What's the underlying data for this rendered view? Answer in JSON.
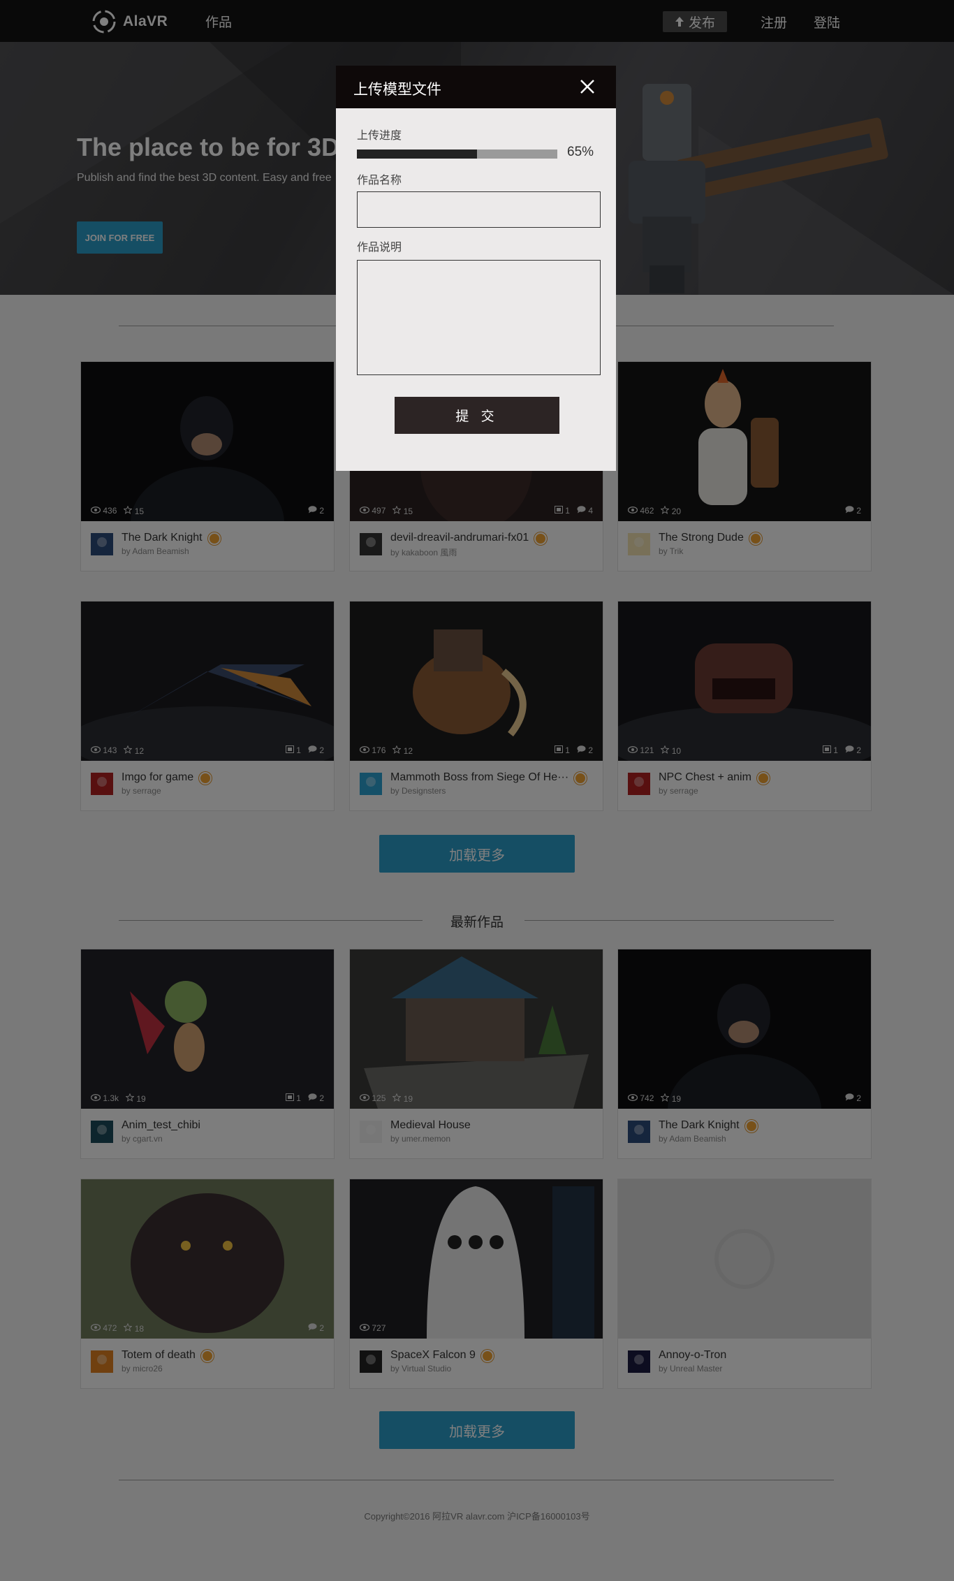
{
  "nav": {
    "logo_text": "AlaVR",
    "works": "作品",
    "publish": "发布",
    "register": "注册",
    "login": "登陆"
  },
  "hero": {
    "title": "The place to be for 3D",
    "subtitle": "Publish and find the best 3D content. Easy and free",
    "join": "JOIN FOR FREE"
  },
  "featured": [
    {
      "title": "The Dark Knight",
      "author": "by Adam Beamish",
      "views": "436",
      "likes": "15",
      "comments": "2",
      "badge": true
    },
    {
      "title": "devil-dreavil-andrumari-fx01",
      "author": "by kakaboon 風雨",
      "views": "497",
      "likes": "15",
      "models": "1",
      "comments": "4",
      "badge": true
    },
    {
      "title": "The Strong Dude",
      "author": "by Trik",
      "views": "462",
      "likes": "20",
      "comments": "2",
      "badge": true
    },
    {
      "title": "Imgo for game",
      "author": "by serrage",
      "views": "143",
      "likes": "12",
      "models": "1",
      "comments": "2",
      "badge": true
    },
    {
      "title": "Mammoth Boss from Siege Of He···",
      "author": "by Designsters",
      "views": "176",
      "likes": "12",
      "models": "1",
      "comments": "2",
      "badge": true
    },
    {
      "title": "NPC Chest + anim",
      "author": "by serrage",
      "views": "121",
      "likes": "10",
      "models": "1",
      "comments": "2",
      "badge": true
    }
  ],
  "load_more": "加载更多",
  "latest_title": "最新作品",
  "latest": [
    {
      "title": "Anim_test_chibi",
      "author": "by cgart.vn",
      "views": "1.3k",
      "likes": "19",
      "models": "1",
      "comments": "2",
      "badge": false
    },
    {
      "title": "Medieval House",
      "author": "by umer.memon",
      "views": "125",
      "likes": "19",
      "badge": false
    },
    {
      "title": "The Dark Knight",
      "author": "by Adam Beamish",
      "views": "742",
      "likes": "19",
      "comments": "2",
      "badge": true
    },
    {
      "title": "Totem of death",
      "author": "by micro26",
      "views": "472",
      "likes": "18",
      "comments": "2",
      "badge": true
    },
    {
      "title": "SpaceX Falcon 9",
      "author": "by Virtual Studio",
      "views": "727",
      "badge": true
    },
    {
      "title": "Annoy-o-Tron",
      "author": "by Unreal Master",
      "badge": false
    }
  ],
  "footer": {
    "copyright": "Copyright©2016 阿拉VR alavr.com 沪ICP备16000103号"
  },
  "modal": {
    "title": "上传模型文件",
    "progress_label": "上传进度",
    "progress": 0.6,
    "progress_text": "65%",
    "name_label": "作品名称",
    "name_value": "",
    "desc_label": "作品说明",
    "desc_value": "",
    "submit": "提 交"
  },
  "colors": {
    "accent": "#2b9cc9",
    "nav_bg": "#121212",
    "badge": "#f0a233",
    "modal_head": "#0e0909",
    "submit_bg": "#2c2424"
  }
}
